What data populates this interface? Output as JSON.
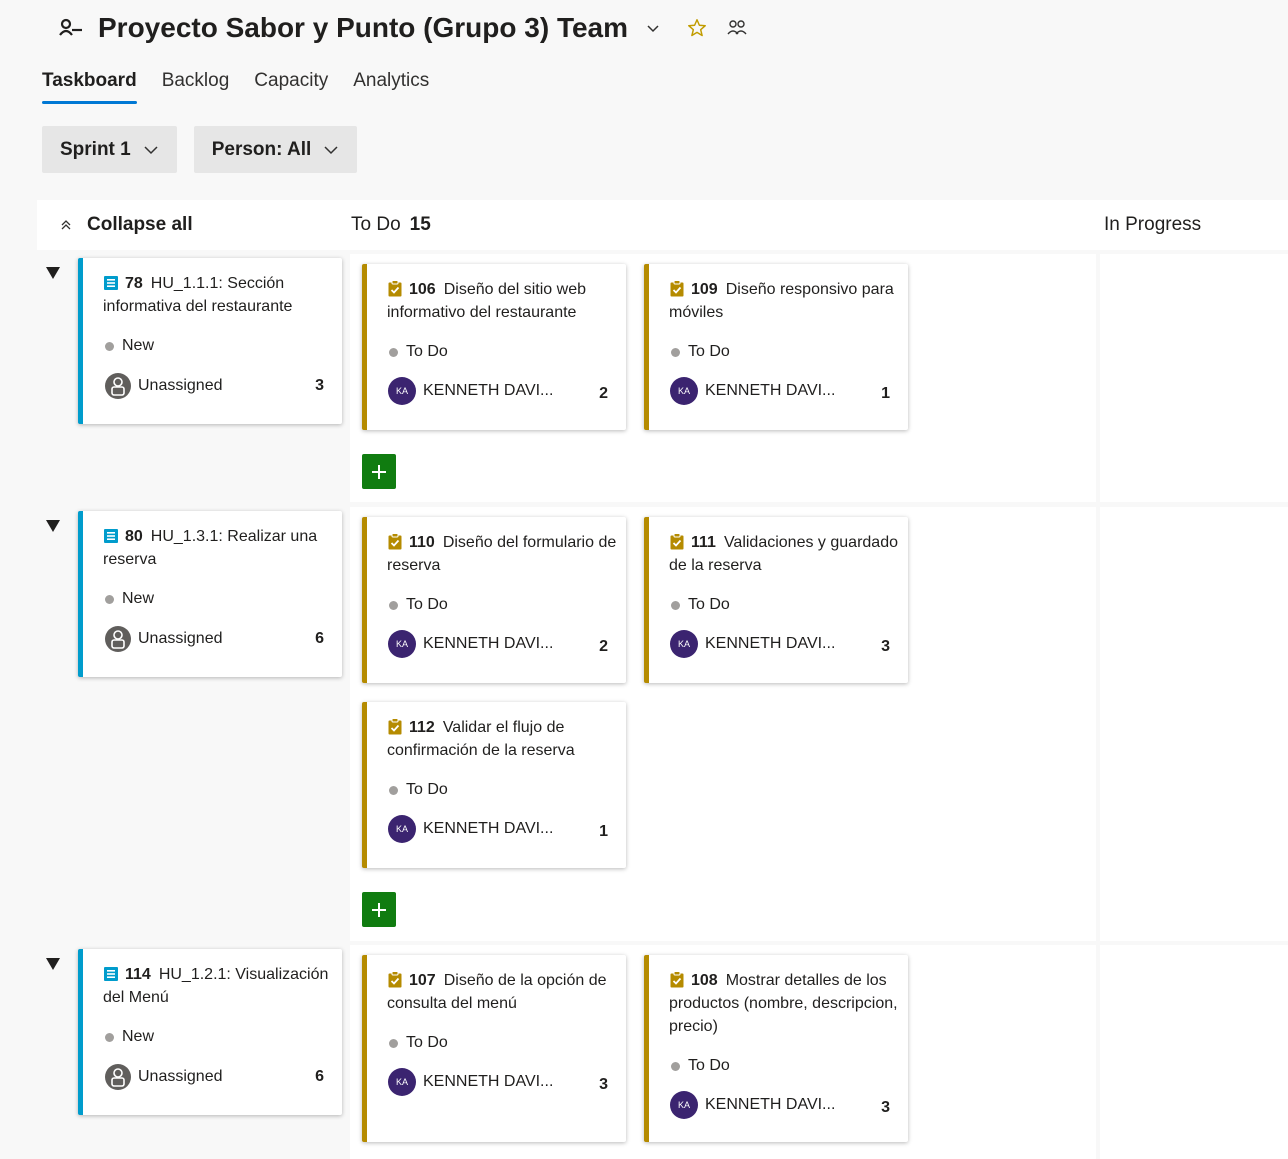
{
  "header": {
    "title": "Proyecto Sabor y Punto (Grupo 3) Team"
  },
  "tabs": [
    {
      "label": "Taskboard",
      "active": true
    },
    {
      "label": "Backlog",
      "active": false
    },
    {
      "label": "Capacity",
      "active": false
    },
    {
      "label": "Analytics",
      "active": false
    }
  ],
  "filters": {
    "sprint": "Sprint 1",
    "person": "Person: All"
  },
  "columns": {
    "collapse_all": "Collapse all",
    "todo_label": "To Do",
    "todo_count": "15",
    "in_progress": "In Progress"
  },
  "rows": [
    {
      "story": {
        "id": "78",
        "title": "HU_1.1.1: Sección informativa del restaurante",
        "state": "New",
        "assignee": "Unassigned",
        "remaining": "3"
      },
      "tasks": [
        {
          "id": "106",
          "title": "Diseño del sitio web informativo del restaurante",
          "state": "To Do",
          "initials": "KA",
          "assignee": "KENNETH DAVI...",
          "remaining": "2"
        },
        {
          "id": "109",
          "title": "Diseño responsivo para móviles",
          "state": "To Do",
          "initials": "KA",
          "assignee": "KENNETH DAVI...",
          "remaining": "1"
        }
      ]
    },
    {
      "story": {
        "id": "80",
        "title": "HU_1.3.1: Realizar una reserva",
        "state": "New",
        "assignee": "Unassigned",
        "remaining": "6"
      },
      "tasks": [
        {
          "id": "110",
          "title": "Diseño del formulario de reserva",
          "state": "To Do",
          "initials": "KA",
          "assignee": "KENNETH DAVI...",
          "remaining": "2"
        },
        {
          "id": "111",
          "title": "Validaciones y guardado de la reserva",
          "state": "To Do",
          "initials": "KA",
          "assignee": "KENNETH DAVI...",
          "remaining": "3"
        },
        {
          "id": "112",
          "title": "Validar el flujo de confirmación de la reserva",
          "state": "To Do",
          "initials": "KA",
          "assignee": "KENNETH DAVI...",
          "remaining": "1"
        }
      ]
    },
    {
      "story": {
        "id": "114",
        "title": "HU_1.2.1: Visualización del Menú",
        "state": "New",
        "assignee": "Unassigned",
        "remaining": "6"
      },
      "tasks": [
        {
          "id": "107",
          "title": "Diseño de la opción de consulta del menú",
          "state": "To Do",
          "initials": "KA",
          "assignee": "KENNETH DAVI...",
          "remaining": "3"
        },
        {
          "id": "108",
          "title": "Mostrar detalles de los productos (nombre, descripcion, precio)",
          "state": "To Do",
          "initials": "KA",
          "assignee": "KENNETH DAVI...",
          "remaining": "3"
        }
      ]
    }
  ],
  "colors": {
    "story_accent": "#009ccc",
    "task_accent": "#b58b00",
    "tab_underline": "#0078d4",
    "add_button": "#107c10",
    "avatar": "#3b2470"
  },
  "icons": {
    "team": "team-icon",
    "favorite": "star-icon",
    "members": "people-icon",
    "story": "user-story-icon",
    "task": "task-clipboard-icon",
    "add": "plus-icon"
  }
}
